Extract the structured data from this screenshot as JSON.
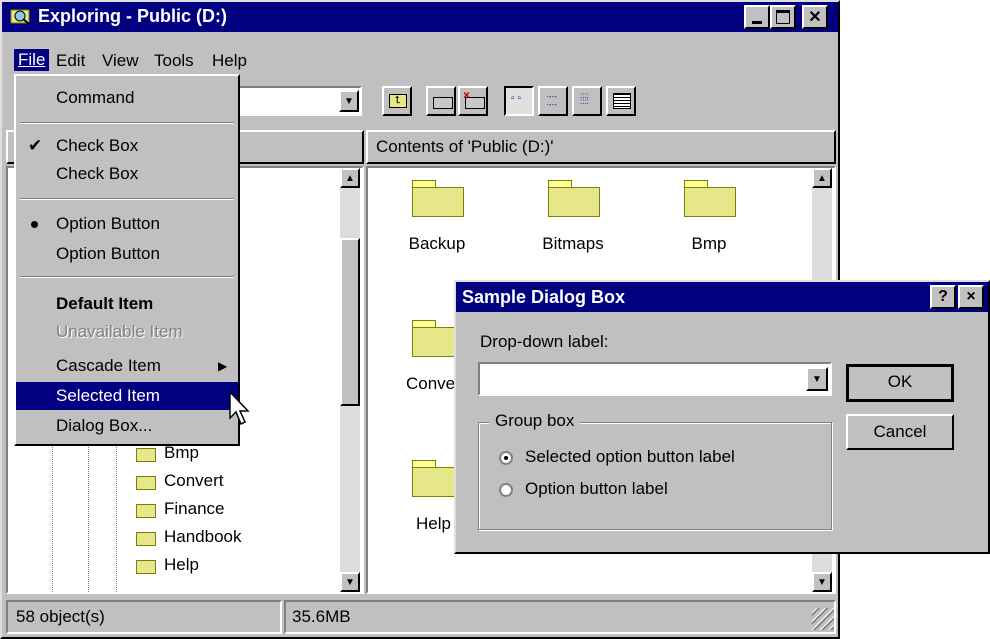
{
  "window": {
    "title": "Exploring - Public (D:)",
    "menu": [
      "File",
      "Edit",
      "View",
      "Tools",
      "Help"
    ]
  },
  "file_menu": {
    "command": "Command",
    "check_checked": "Check Box",
    "check_unchecked": "Check Box",
    "option_selected": "Option Button",
    "option_unselected": "Option Button",
    "default_item": "Default Item",
    "unavailable_item": "Unavailable Item",
    "cascade_item": "Cascade Item",
    "selected_item": "Selected Item",
    "dialog_box": "Dialog Box..."
  },
  "content_header": "Contents of 'Public (D:)'",
  "tree_items": [
    "Bmp",
    "Convert",
    "Finance",
    "Handbook",
    "Help"
  ],
  "folders": [
    "Backup",
    "Bitmaps",
    "Bmp",
    "Conve",
    "Help"
  ],
  "status": {
    "objects": "58 object(s)",
    "size": "35.6MB"
  },
  "dialog": {
    "title": "Sample Dialog Box",
    "dropdown_label": "Drop-down label:",
    "dropdown_value": "",
    "group_label": "Group box",
    "option_selected": "Selected option button label",
    "option": "Option button label",
    "ok": "OK",
    "cancel": "Cancel",
    "help_btn": "?",
    "close_btn": "×"
  },
  "colors": {
    "titlebar": "#000080",
    "face": "#c0c0c0",
    "highlight": "#000080"
  }
}
